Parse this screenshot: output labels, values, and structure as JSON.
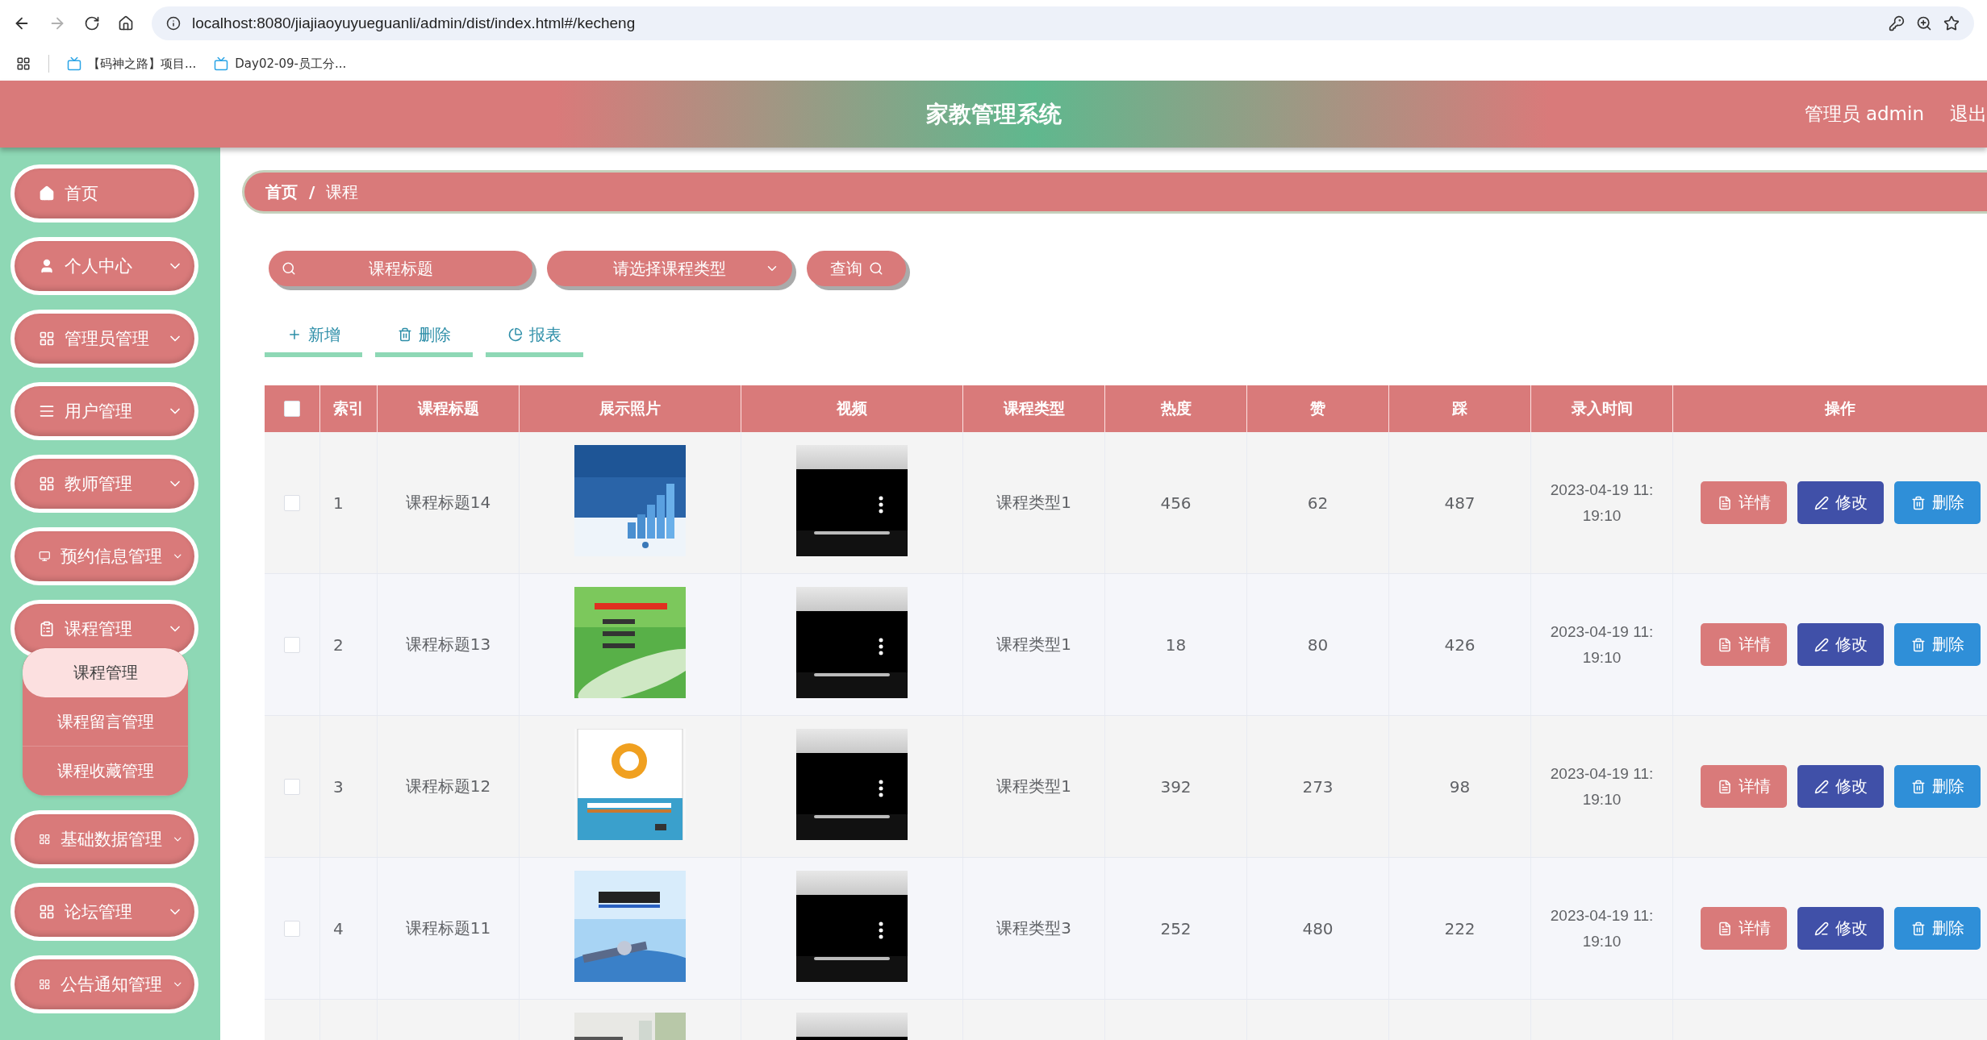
{
  "browser": {
    "url": "localhost:8080/jiajiaoyuyueguanli/admin/dist/index.html#/kecheng",
    "bookmarks": [
      "【码神之路】项目...",
      "Day02-09-员工分..."
    ]
  },
  "header": {
    "title": "家教管理系统",
    "user": "管理员 admin",
    "logout": "退出"
  },
  "sidebar": {
    "items": [
      {
        "label": "首页",
        "has_submenu": false
      },
      {
        "label": "个人中心",
        "has_submenu": true
      },
      {
        "label": "管理员管理",
        "has_submenu": true
      },
      {
        "label": "用户管理",
        "has_submenu": true
      },
      {
        "label": "教师管理",
        "has_submenu": true
      },
      {
        "label": "预约信息管理",
        "has_submenu": true
      },
      {
        "label": "课程管理",
        "has_submenu": true,
        "expanded": true,
        "children": [
          {
            "label": "课程管理",
            "selected": true
          },
          {
            "label": "课程留言管理",
            "selected": false
          },
          {
            "label": "课程收藏管理",
            "selected": false
          }
        ]
      },
      {
        "label": "基础数据管理",
        "has_submenu": true
      },
      {
        "label": "论坛管理",
        "has_submenu": true
      },
      {
        "label": "公告通知管理",
        "has_submenu": true
      }
    ]
  },
  "breadcrumb": {
    "items": [
      "首页",
      "课程"
    ],
    "separator": "/"
  },
  "search": {
    "title_placeholder": "课程标题",
    "type_placeholder": "请选择课程类型",
    "button": "查询"
  },
  "actions": [
    "新增",
    "删除",
    "报表"
  ],
  "table": {
    "all_checked": false,
    "columns": [
      "索引",
      "课程标题",
      "展示照片",
      "视频",
      "课程类型",
      "热度",
      "赞",
      "踩",
      "录入时间",
      "操作"
    ],
    "rows": [
      {
        "checked": false,
        "index": "1",
        "title": "课程标题14",
        "video": {
          "kind": "player"
        },
        "type": "课程类型1",
        "heat": "456",
        "likes": "62",
        "dislikes": "487",
        "time": "2023-04-19 11:19:10",
        "buttons": [
          "详情",
          "修改",
          "删除"
        ]
      },
      {
        "checked": false,
        "index": "2",
        "title": "课程标题13",
        "video": {
          "kind": "player"
        },
        "type": "课程类型1",
        "heat": "18",
        "likes": "80",
        "dislikes": "426",
        "time": "2023-04-19 11:19:10",
        "buttons": [
          "详情",
          "修改",
          "删除"
        ]
      },
      {
        "checked": false,
        "index": "3",
        "title": "课程标题12",
        "video": {
          "kind": "player"
        },
        "type": "课程类型1",
        "heat": "392",
        "likes": "273",
        "dislikes": "98",
        "time": "2023-04-19 11:19:10",
        "buttons": [
          "详情",
          "修改",
          "删除"
        ]
      },
      {
        "checked": false,
        "index": "4",
        "title": "课程标题11",
        "video": {
          "kind": "player"
        },
        "type": "课程类型3",
        "heat": "252",
        "likes": "480",
        "dislikes": "222",
        "time": "2023-04-19 11:19:10",
        "buttons": [
          "详情",
          "修改",
          "删除"
        ]
      },
      {
        "video": {
          "kind": "player"
        }
      }
    ]
  }
}
